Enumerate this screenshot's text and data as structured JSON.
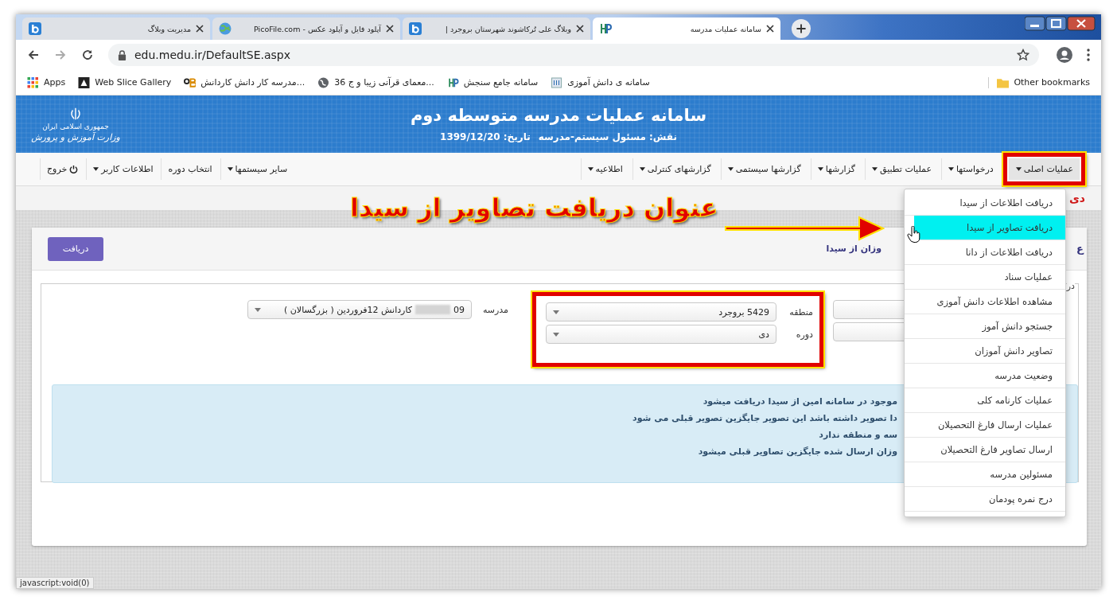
{
  "browser": {
    "tabs": [
      {
        "title": "سامانه عملیات مدرسه",
        "selected": true
      },
      {
        "title": "وبلاگ علی تُرکاشوند شهرستان بروجرد |",
        "selected": false
      },
      {
        "title": "آپلود فایل و آپلود عکس - PicoFile.com",
        "selected": false
      },
      {
        "title": "مدیریت وبلاگ",
        "selected": false
      }
    ],
    "url": "edu.medu.ir/DefaultSE.aspx",
    "bookmarks": [
      {
        "label": "سامانه ی دانش آموزی"
      },
      {
        "label": "سامانه جامع سنجش"
      },
      {
        "label": "36 معمای قرآنی زیبا و ج..."
      },
      {
        "label": "مدرسه کار دانش کاردانش..."
      },
      {
        "label": "Web Slice Gallery"
      },
      {
        "label": "Apps"
      }
    ],
    "other_bookmarks": "Other bookmarks",
    "status_url": "javascript:void(0)"
  },
  "site": {
    "logo_lines": [
      "جمهوری اسلامی ایران",
      "وزارت آموزش و پرورش"
    ],
    "title": "سامانه عملیات مدرسه متوسطه دوم",
    "role": "نقش: مسئول سیستم-مدرسه",
    "date": "تاریخ: 1399/12/20"
  },
  "nav": {
    "main": [
      {
        "label": "عملیات اصلی",
        "dropdown": true,
        "selected": true,
        "highlighted": true
      },
      {
        "label": "درخواستها",
        "dropdown": true,
        "selected": false,
        "highlighted": false
      },
      {
        "label": "عملیات تطبیق",
        "dropdown": true,
        "selected": false,
        "highlighted": false
      },
      {
        "label": "گزارشها",
        "dropdown": true,
        "selected": false,
        "highlighted": false
      },
      {
        "label": "گزارشها سیستمی",
        "dropdown": true,
        "selected": false,
        "highlighted": false
      },
      {
        "label": "گزارشهای کنترلی",
        "dropdown": true,
        "selected": false,
        "highlighted": false
      },
      {
        "label": "اطلاعیه",
        "dropdown": true,
        "selected": false,
        "highlighted": false
      }
    ],
    "secondary": [
      {
        "label": "سایر سیستمها",
        "kind": "dropdown"
      },
      {
        "label": "انتخاب دوره",
        "kind": "plain"
      },
      {
        "label": "اطلاعات کاربر",
        "kind": "dropdown"
      },
      {
        "label": "خروج",
        "kind": "logout"
      }
    ]
  },
  "period_badge": "دی",
  "page": {
    "title_start": "ع",
    "title_end": "وزان از سیدا",
    "receive_button": "دریافت",
    "legend": "در",
    "fields_highlighted": true,
    "fields": [
      {
        "label": "منطقه",
        "value": "5429 بروجرد",
        "blurred": false
      },
      {
        "label": "دوره",
        "value": "دی",
        "blurred": false
      },
      {
        "label": "مدرسه",
        "value": "09",
        "value_rest": "کاردانش 12فروردین ( بزرگسالان )",
        "blurred": true
      }
    ],
    "notes": [
      "موجود در سامانه امین از سیدا دریافت میشود",
      "دا تصویر داشته باشد این تصویر جایگزین تصویر قبلی می شود",
      "سه و منطقه ندارد",
      "وزان ارسال شده جایگزین تصاویر قبلی میشود"
    ]
  },
  "menu": {
    "items": [
      {
        "label": "دریافت اطلاعات از سیدا",
        "selected": false
      },
      {
        "label": "دریافت تصاویر از سیدا",
        "selected": true
      },
      {
        "label": "دریافت اطلاعات از دانا",
        "selected": false
      },
      {
        "label": "عملیات سناد",
        "selected": false
      },
      {
        "label": "مشاهده اطلاعات دانش آموزی",
        "selected": false
      },
      {
        "label": "جستجو دانش آموز",
        "selected": false
      },
      {
        "label": "تصاویر دانش آموزان",
        "selected": false
      },
      {
        "label": "وضعیت مدرسه",
        "selected": false
      },
      {
        "label": "عملیات کارنامه کلی",
        "selected": false
      },
      {
        "label": "عملیات ارسال فارغ التحصیلان",
        "selected": false
      },
      {
        "label": "ارسال تصاویر فارغ التحصیلان",
        "selected": false
      },
      {
        "label": "مسئولین مدرسه",
        "selected": false
      },
      {
        "label": "درج نمره پودمان",
        "selected": false
      }
    ]
  },
  "annotation": {
    "text": "عنوان دریافت تصاویر از سیدا"
  }
}
